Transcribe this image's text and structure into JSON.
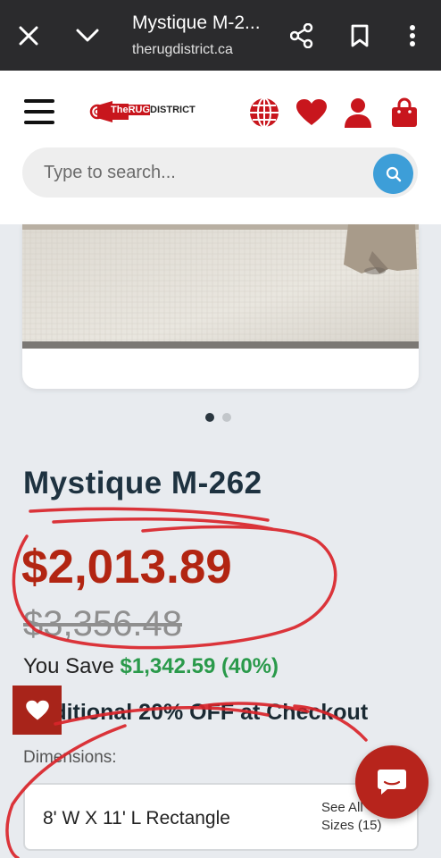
{
  "browser": {
    "title": "Mystique M-2...",
    "url": "therugdistrict.ca",
    "close_icon": "close-icon",
    "collapse_icon": "chevron-down-icon",
    "share_icon": "share-icon",
    "bookmark_icon": "bookmark-icon",
    "menu_icon": "more-vert-icon"
  },
  "header": {
    "logo_text_the": "The",
    "logo_text_rug": "RUG",
    "logo_text_district": "DISTRICT",
    "icons": [
      "globe-icon",
      "heart-icon",
      "user-icon",
      "shopping-bag-icon"
    ],
    "accent_color": "#c8161d"
  },
  "search": {
    "placeholder": "Type to search...",
    "button_color": "#3d9ed8"
  },
  "carousel": {
    "active_index": 0,
    "count": 2
  },
  "product": {
    "title": "Mystique M-262",
    "sale_price": "$2,013.89",
    "original_price": "$3,356.48",
    "you_save_label": "You Save",
    "you_save_amount": "$1,342.59 (40%)",
    "promo": "Additional 20% OFF at Checkout",
    "dimensions_label": "Dimensions:",
    "dimensions_value": "8' W X 11' L Rectangle",
    "see_all_line1": "See All",
    "see_all_line2": "Sizes (15)"
  },
  "colors": {
    "price_red": "#b22512",
    "save_green": "#2a9a4b",
    "annotation_red": "#d9242a"
  }
}
